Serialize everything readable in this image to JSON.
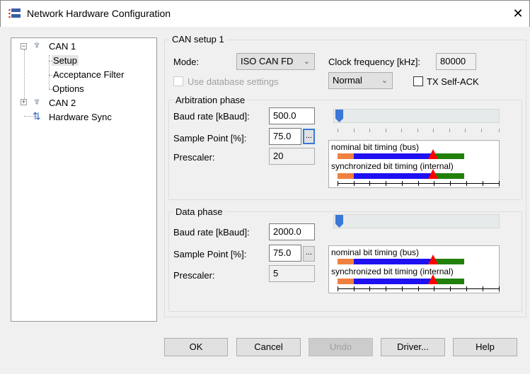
{
  "window": {
    "title": "Network Hardware Configuration",
    "close": "✕"
  },
  "tree": {
    "can1": "CAN 1",
    "setup": "Setup",
    "acceptance": "Acceptance Filter",
    "options": "Options",
    "can2": "CAN 2",
    "sync": "Hardware Sync"
  },
  "setup": {
    "group_title": "CAN setup 1",
    "mode_label": "Mode:",
    "mode_value": "ISO CAN FD",
    "clock_label": "Clock frequency [kHz]:",
    "clock_value": "80000",
    "use_db": "Use database settings",
    "op_mode": "Normal",
    "tx_self_ack": "TX Self-ACK",
    "arbitration": {
      "title": "Arbitration phase",
      "baud_label": "Baud rate [kBaud]:",
      "baud": "500.0",
      "sp_label": "Sample Point [%]:",
      "sp": "75.0",
      "presc_label": "Prescaler:",
      "presc": "20",
      "nominal": "nominal bit timing (bus)",
      "sync": "synchronized bit timing (internal)",
      "slider_fraction": 0.0
    },
    "data": {
      "title": "Data phase",
      "baud_label": "Baud rate [kBaud]:",
      "baud": "2000.0",
      "sp_label": "Sample Point [%]:",
      "sp": "75.0",
      "presc_label": "Prescaler:",
      "presc": "5",
      "nominal": "nominal bit timing (bus)",
      "sync": "synchronized bit timing (internal)",
      "slider_fraction": 0.0
    },
    "dots": "..."
  },
  "buttons": {
    "ok": "OK",
    "cancel": "Cancel",
    "undo": "Undo",
    "driver": "Driver...",
    "help": "Help"
  }
}
